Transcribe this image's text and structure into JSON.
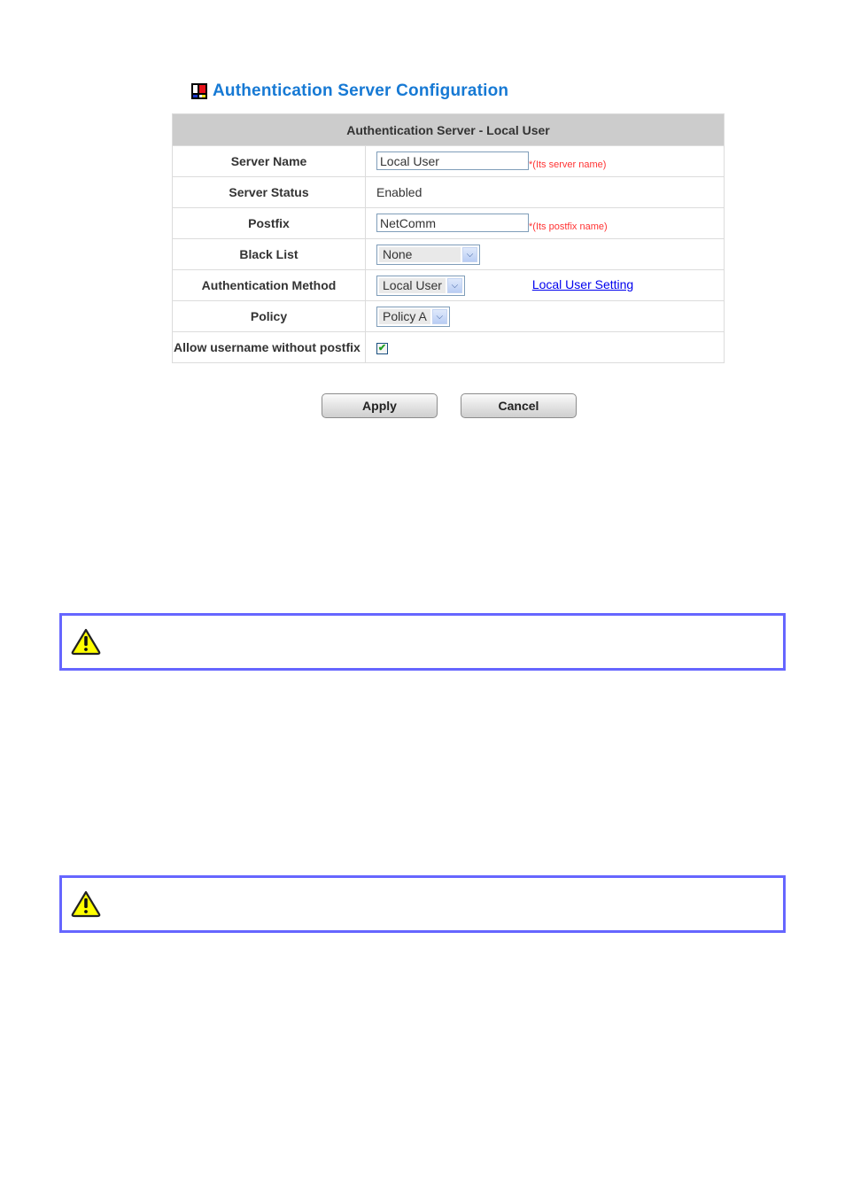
{
  "page": {
    "title": "Authentication Server Configuration",
    "title_icon": "config-window-icon"
  },
  "table": {
    "header": "Authentication Server - Local User",
    "rows": {
      "server_name": {
        "label": "Server Name",
        "value": "Local User",
        "hint": "*(Its server name)"
      },
      "server_status": {
        "label": "Server Status",
        "value": "Enabled"
      },
      "postfix": {
        "label": "Postfix",
        "value": "NetComm",
        "hint": "*(Its postfix name)"
      },
      "black_list": {
        "label": "Black List",
        "selected": "None"
      },
      "auth_method": {
        "label": "Authentication Method",
        "selected": "Local User",
        "link": "Local User Setting"
      },
      "policy": {
        "label": "Policy",
        "selected": "Policy A"
      },
      "allow_no_postfix": {
        "label": "Allow username without postfix",
        "checked": true,
        "check_glyph": "✔"
      }
    }
  },
  "buttons": {
    "apply": "Apply",
    "cancel": "Cancel"
  },
  "notes": [
    {
      "icon": "warning-icon",
      "text": ""
    },
    {
      "icon": "warning-icon",
      "text": ""
    }
  ],
  "colors": {
    "title": "#1679d4",
    "header_bg": "#cccccc",
    "hint": "#ff3333",
    "link": "#0000ee",
    "note_border": "#6666ff",
    "warning_fill": "#ffff00"
  }
}
